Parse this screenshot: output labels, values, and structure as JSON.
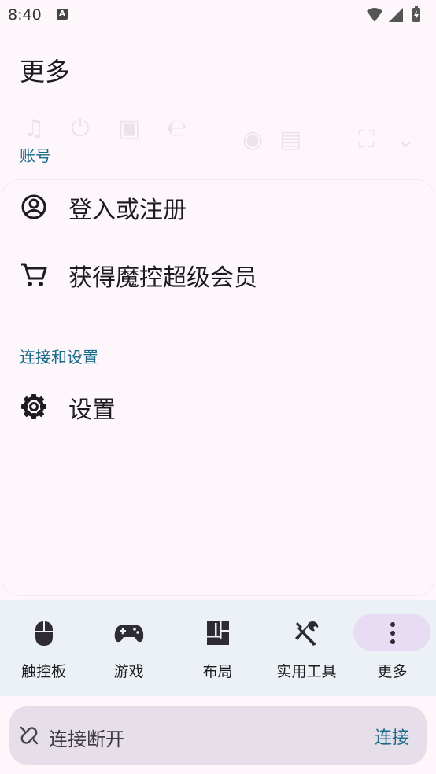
{
  "status_bar": {
    "time": "8:40",
    "notification_badge": "A"
  },
  "page": {
    "title": "更多"
  },
  "sections": [
    {
      "header": "账号",
      "items": [
        {
          "label": "登入或注册",
          "icon": "account-circle-icon"
        },
        {
          "label": "获得魔控超级会员",
          "icon": "shopping-cart-icon"
        }
      ]
    },
    {
      "header": "连接和设置",
      "items": [
        {
          "label": "设置",
          "icon": "gear-icon"
        }
      ]
    }
  ],
  "bottom_nav": [
    {
      "label": "触控板",
      "icon": "mouse-icon"
    },
    {
      "label": "游戏",
      "icon": "gamepad-icon"
    },
    {
      "label": "布局",
      "icon": "layout-icon"
    },
    {
      "label": "实用工具",
      "icon": "tools-icon"
    },
    {
      "label": "更多",
      "icon": "more-vertical-icon",
      "active": true
    }
  ],
  "connection": {
    "status": "连接断开",
    "action": "连接"
  },
  "colors": {
    "accent": "#1a6a8a",
    "active_pill": "#e7dcf3",
    "nav_bg": "#ecf1f5",
    "conn_bar_bg": "#e6dfe9"
  }
}
